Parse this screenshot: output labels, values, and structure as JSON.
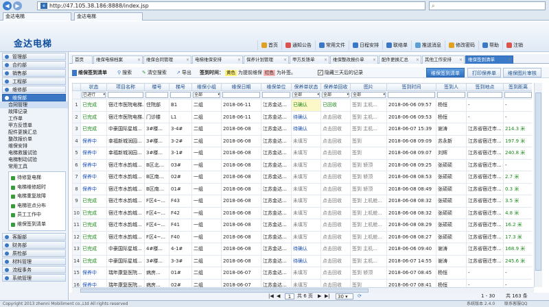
{
  "browser": {
    "url": "http://47.105.38.186:8888/index.jsp",
    "search_placeholder": "",
    "tabs": [
      "金达电梯",
      "金达电梯"
    ]
  },
  "app": {
    "logo": "金达电梯",
    "topnav": [
      {
        "label": "首页",
        "icon": "home-icon",
        "color": "#e0a020"
      },
      {
        "label": "通知公告",
        "icon": "bell-icon",
        "color": "#d9534f"
      },
      {
        "label": "常用文件",
        "icon": "folder-icon",
        "color": "#3a78c6"
      },
      {
        "label": "日程安排",
        "icon": "calendar-icon",
        "color": "#3a78c6"
      },
      {
        "label": "联络单",
        "icon": "contact-icon",
        "color": "#3a78c6"
      },
      {
        "label": "推送消息",
        "icon": "message-icon",
        "color": "#5aa0d6"
      },
      {
        "label": "修改密码",
        "icon": "key-icon",
        "color": "#e0a020"
      },
      {
        "label": "帮助",
        "icon": "help-icon",
        "color": "#3a78c6"
      },
      {
        "label": "注销",
        "icon": "logout-icon",
        "color": "#d9534f"
      }
    ]
  },
  "sidebar": {
    "groups_top": [
      "管理部",
      "合约部",
      "销售部",
      "工程部",
      "维修部"
    ],
    "open_group": "维保部",
    "items": [
      "合同管理",
      "故障记录",
      "工作单",
      "甲方反馈单",
      "配件更换汇总",
      "整改报价单",
      "维保安排",
      "电梯救援试验",
      "电梯制动试验",
      "常用工具"
    ],
    "subitems": [
      "待修复电梯",
      "电梯维修超时",
      "电梯重复故障",
      "电梯驻点分布",
      "员工工作中",
      "维保签到清单"
    ],
    "groups_bottom": [
      "客服部",
      "财务部",
      "质检部",
      "材料管理",
      "流程事务",
      "系统管理"
    ]
  },
  "main": {
    "tabs": [
      "首页",
      "维保电梯档案",
      "维保合同管理",
      "电梯维保安排",
      "保养计划管理",
      "甲方反馈单",
      "维保整改报价单",
      "配件更换汇总",
      "其他工作安排",
      "维保签到清单"
    ],
    "toolbar": {
      "title": "维保签到清单",
      "search": "搜索",
      "clear": "清空搜索",
      "export": "导出",
      "legend_label": "签到时间：",
      "legend_yellow": "黄色",
      "legend_yellow_text": "为提前维保",
      "legend_red": "红色",
      "legend_red_text": "为补签。",
      "hide_label": "隐藏三天后的记录",
      "right_buttons": [
        "维保签到清单",
        "打印保养单",
        "维保图片审核"
      ]
    },
    "columns": [
      "状态",
      "项目名称",
      "楼号",
      "梯号",
      "维保小组",
      "维保日期",
      "维保单位",
      "保养单状态",
      "保养单回收",
      "图片",
      "签到时间",
      "签到人",
      "签到地点",
      "签到距离",
      ""
    ],
    "filters": [
      "已进行",
      "",
      "",
      "",
      "全部",
      "",
      "",
      "全部",
      "全部",
      "全部",
      "",
      "",
      "",
      "",
      ""
    ],
    "rows": [
      [
        "已完成",
        "宿迁市医院电梯...",
        "住院部",
        "B1",
        "二组",
        "2018-06-11",
        "江苏金达...",
        "已确认",
        "已回收",
        "签到  主机...",
        "2018-06-06 09:57",
        "杨恒",
        "-",
        "-",
        "20"
      ],
      [
        "已完成",
        "宿迁市医院电梯...",
        "门诊楼",
        "L1",
        "二组",
        "2018-06-11",
        "江苏金达...",
        "待确认",
        "点击回收",
        "签到  主机...",
        "2018-06-06 09:53",
        "杨恒",
        "-",
        "-",
        "20"
      ],
      [
        "已完成",
        "中豪国际星城...",
        "3#楼...",
        "3-4#",
        "二组",
        "2018-06-08",
        "江苏金达...",
        "待确认",
        "点击回收",
        "签到  主机...",
        "2018-06-07 15:39",
        "谢涛",
        "江苏省宿迁市...",
        "214.3 米",
        "20"
      ],
      [
        "保养中",
        "幸福新城润园...",
        "3#楼...",
        "3-2#",
        "二组",
        "2018-06-08",
        "江苏金达...",
        "未填写",
        "点击回收",
        "签到",
        "2018-06-08 09:09",
        "苏永新",
        "江苏省宿迁市...",
        "197.9 米",
        "20"
      ],
      [
        "保养中",
        "幸福新城润园...",
        "3#楼...",
        "3-1#",
        "一组",
        "2018-06-08",
        "江苏金达...",
        "未填写",
        "点击回收",
        "签到",
        "2018-06-08 09:07",
        "刘辉",
        "江苏省宿迁市...",
        "240.8 米",
        "20"
      ],
      [
        "保养中",
        "宿迁市水韵城...",
        "B区北...",
        "03#",
        "一组",
        "2018-06-08",
        "江苏金达...",
        "未填写",
        "点击回收",
        "签到  轿顶",
        "2018-06-08 09:25",
        "张硕硕",
        "江苏省宿迁市...",
        "-",
        "20"
      ],
      [
        "保养中",
        "宿迁市水韵城...",
        "B区南...",
        "02#",
        "一组",
        "2018-06-08",
        "江苏金达...",
        "未填写",
        "点击回收",
        "签到  轿顶",
        "2018-06-08 08:53",
        "张硕硕",
        "江苏省宿迁市...",
        "2.7 米",
        "20"
      ],
      [
        "保养中",
        "宿迁市水韵城...",
        "B区南...",
        "01#",
        "一组",
        "2018-06-08",
        "江苏金达...",
        "未填写",
        "点击回收",
        "签到  轿顶",
        "2018-06-08 08:49",
        "张硕硕",
        "江苏省宿迁市...",
        "0.3 米",
        "20"
      ],
      [
        "已完成",
        "宿迁市水韵城...",
        "F区4~...",
        "F43",
        "一组",
        "2018-06-08",
        "江苏金达...",
        "未填写",
        "点击回收",
        "签到  上机舱...",
        "2018-06-08 08:32",
        "张硕硕",
        "江苏省宿迁市...",
        "3.5 米",
        "20"
      ],
      [
        "已完成",
        "宿迁市水韵城...",
        "F区4~...",
        "F42",
        "一组",
        "2018-06-08",
        "江苏金达...",
        "未填写",
        "点击回收",
        "签到  上机舱...",
        "2018-06-08 08:32",
        "张硕硕",
        "江苏省宿迁市...",
        "4.8 米",
        "20"
      ],
      [
        "已完成",
        "宿迁市水韵城...",
        "F区4~...",
        "F41",
        "一组",
        "2018-06-08",
        "江苏金达...",
        "未填写",
        "点击回收",
        "签到  上机舱...",
        "2018-06-08 08:29",
        "张硕硕",
        "江苏省宿迁市...",
        "16.2 米",
        "20"
      ],
      [
        "已完成",
        "宿迁市水韵城...",
        "F区4~...",
        "F40",
        "一组",
        "2018-06-08",
        "江苏金达...",
        "未填写",
        "点击回收",
        "签到  上机舱...",
        "2018-06-08 08:27",
        "张硕硕",
        "江苏省宿迁市...",
        "17.3 米",
        "20"
      ],
      [
        "已完成",
        "中豪国际星城...",
        "4#楼...",
        "4-1#",
        "二组",
        "2018-06-08",
        "江苏金达...",
        "待确认",
        "点击回收",
        "签到  主机...",
        "2018-06-06 09:40",
        "谢涛",
        "江苏省宿迁市...",
        "168.9 米",
        "20"
      ],
      [
        "已完成",
        "中豪国际星城...",
        "3#楼...",
        "3-3#",
        "二组",
        "2018-06-08",
        "江苏金达...",
        "待确认",
        "点击回收",
        "签到  主机...",
        "2018-06-07 14:55",
        "谢涛",
        "江苏省宿迁市...",
        "245.6 米",
        "20"
      ],
      [
        "保养中",
        "瑞年康复医院...",
        "病房...",
        "01#",
        "二组",
        "2018-06-07",
        "江苏金达...",
        "未填写",
        "点击回收",
        "签到  轿顶",
        "2018-06-07 08:45",
        "杨恒",
        "-",
        "-",
        "20"
      ],
      [
        "保养中",
        "瑞年康复医院...",
        "病房...",
        "02#",
        "二组",
        "2018-06-07",
        "江苏金达...",
        "未填写",
        "点击回收",
        "签到",
        "2018-06-07 08:41",
        "杨恒",
        "-",
        "-",
        "20"
      ]
    ],
    "pager": {
      "page": "1",
      "total_pages_text": "共 6 页",
      "page_size": "30",
      "range_text": "1 - 30",
      "total_text": "共 163 条"
    }
  },
  "footer": {
    "copyright": "Copyright 2013 zhenni Mobiliment co.,Ltd  All rights reserved",
    "version": "系统版本 2.4.0",
    "extra": "联系客服QQ"
  },
  "colors": {
    "accent": "#3b7ac8",
    "done": "#1a8a1a",
    "progress": "#1a4fb8",
    "confirmed_bg": "#fdf8c7"
  }
}
